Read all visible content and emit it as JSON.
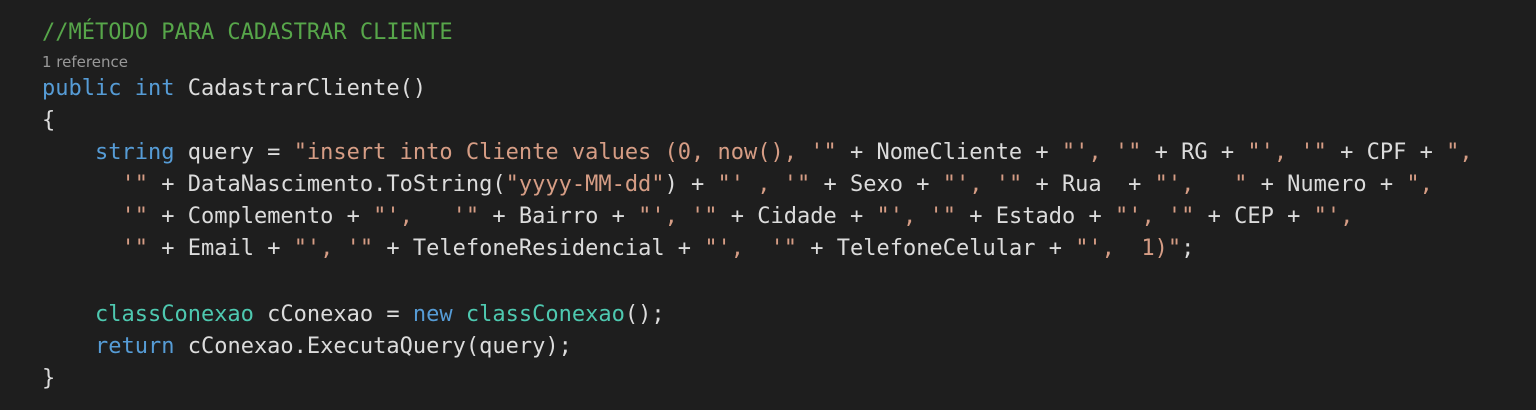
{
  "editor": {
    "background": "#1e1e1e",
    "colors": {
      "comment": "#57a64a",
      "keyword": "#569cd6",
      "type": "#4ec9b0",
      "string": "#d69d85",
      "text": "#dcdcdc",
      "codelens": "#999999"
    },
    "comment": "//MÉTODO PARA CADASTRAR CLIENTE",
    "codelens": "1 reference",
    "signature": {
      "modifier": "public",
      "return_type": "int",
      "name": " CadastrarCliente()"
    },
    "open_brace": "{",
    "close_brace": "}",
    "query_decl": {
      "type": "string",
      "var": " query = ",
      "l1": [
        {
          "k": "str",
          "t": "\"insert into Cliente values (0, now(), '\""
        },
        {
          "k": "plain",
          "t": " + NomeCliente + "
        },
        {
          "k": "str",
          "t": "\"', '\""
        },
        {
          "k": "plain",
          "t": " + RG + "
        },
        {
          "k": "str",
          "t": "\"', '\""
        },
        {
          "k": "plain",
          "t": " + CPF + "
        },
        {
          "k": "str",
          "t": "\","
        }
      ],
      "l2": [
        {
          "k": "str",
          "t": "'\""
        },
        {
          "k": "plain",
          "t": " + DataNascimento.ToString("
        },
        {
          "k": "str",
          "t": "\"yyyy-MM-dd\""
        },
        {
          "k": "plain",
          "t": ") + "
        },
        {
          "k": "str",
          "t": "\"' , '\""
        },
        {
          "k": "plain",
          "t": " + Sexo + "
        },
        {
          "k": "str",
          "t": "\"', '\""
        },
        {
          "k": "plain",
          "t": " + Rua  + "
        },
        {
          "k": "str",
          "t": "\"',   \""
        },
        {
          "k": "plain",
          "t": " + Numero + "
        },
        {
          "k": "str",
          "t": "\","
        }
      ],
      "l3": [
        {
          "k": "str",
          "t": "'\""
        },
        {
          "k": "plain",
          "t": " + Complemento + "
        },
        {
          "k": "str",
          "t": "\"',   '\""
        },
        {
          "k": "plain",
          "t": " + Bairro + "
        },
        {
          "k": "str",
          "t": "\"', '\""
        },
        {
          "k": "plain",
          "t": " + Cidade + "
        },
        {
          "k": "str",
          "t": "\"', '\""
        },
        {
          "k": "plain",
          "t": " + Estado + "
        },
        {
          "k": "str",
          "t": "\"', '\""
        },
        {
          "k": "plain",
          "t": " + CEP + "
        },
        {
          "k": "str",
          "t": "\"',"
        }
      ],
      "l4": [
        {
          "k": "str",
          "t": "'\""
        },
        {
          "k": "plain",
          "t": " + Email + "
        },
        {
          "k": "str",
          "t": "\"', '\""
        },
        {
          "k": "plain",
          "t": " + TelefoneResidencial + "
        },
        {
          "k": "str",
          "t": "\"',  '\""
        },
        {
          "k": "plain",
          "t": " + TelefoneCelular + "
        },
        {
          "k": "str",
          "t": "\"',  1)\""
        },
        {
          "k": "plain",
          "t": ";"
        }
      ]
    },
    "conexao_decl": {
      "type": "classConexao",
      "var": " cConexao = ",
      "new_kw": "new",
      "space": " ",
      "ctor_type": "classConexao",
      "tail": "();"
    },
    "return_stmt": {
      "kw": "return",
      "expr": " cConexao.ExecutaQuery(query);"
    }
  }
}
